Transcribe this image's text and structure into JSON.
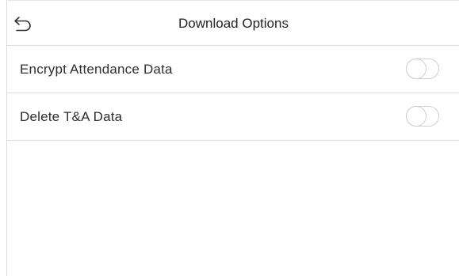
{
  "header": {
    "back_icon": "back-arrow-icon",
    "title": "Download Options"
  },
  "options": [
    {
      "label": "Encrypt Attendance Data",
      "enabled": false
    },
    {
      "label": "Delete T&A Data",
      "enabled": false
    }
  ],
  "colors": {
    "divider": "#dedede",
    "toggle_border": "#cfcfcf",
    "text": "#2e2e2e",
    "background": "#ffffff"
  }
}
